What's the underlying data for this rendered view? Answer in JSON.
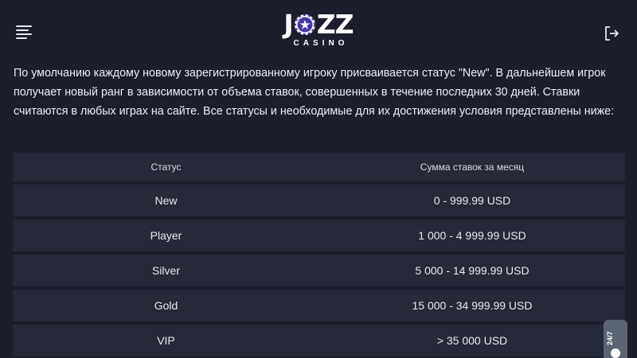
{
  "header": {
    "menu_icon": "hamburger-menu-icon",
    "logo": {
      "main": "JOZZ",
      "sub": "CASINO"
    },
    "logout_icon": "logout-icon"
  },
  "intro_text": "По умолчанию каждому новому зарегистрированному игроку присваивается статус \"New\". В дальнейшем игрок получает новый ранг в зависимости от объема ставок, совершенных в течение последних 30 дней. Ставки считаются в любых играх на сайте. Все статусы и необходимые для их достижения условия представлены ниже:",
  "table": {
    "headers": {
      "status": "Статус",
      "sum": "Сумма ставок за месяц"
    },
    "rows": [
      {
        "status": "New",
        "sum": "0 - 999.99 USD"
      },
      {
        "status": "Player",
        "sum": "1 000 - 4 999.99 USD"
      },
      {
        "status": "Silver",
        "sum": "5 000 - 14 999.99 USD"
      },
      {
        "status": "Gold",
        "sum": "15 000 - 34 999.99 USD"
      },
      {
        "status": "VIP",
        "sum": "> 35 000 USD"
      }
    ]
  },
  "support": {
    "label": "24/7"
  },
  "colors": {
    "background": "#1c1e2c",
    "row": "#262938",
    "accent": "#4a3aa8"
  }
}
